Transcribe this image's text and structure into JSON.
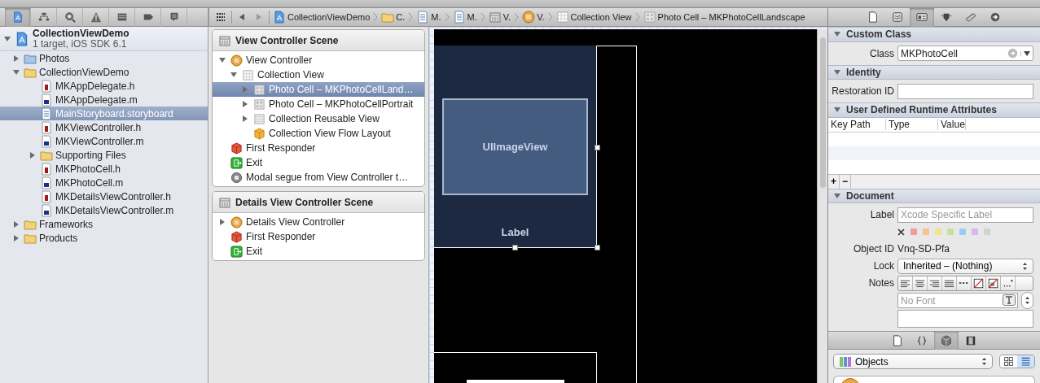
{
  "navigator": {
    "tabs": [
      {
        "kind": "project",
        "selected": true
      },
      {
        "kind": "symbol",
        "selected": false
      },
      {
        "kind": "search",
        "selected": false
      },
      {
        "kind": "issue",
        "selected": false
      },
      {
        "kind": "debug",
        "selected": false
      },
      {
        "kind": "breakpoint",
        "selected": false
      },
      {
        "kind": "log",
        "selected": false
      }
    ],
    "project": {
      "name": "CollectionViewDemo",
      "subtitle": "1 target, iOS SDK 6.1",
      "expanded": true,
      "selected": false
    },
    "items": [
      {
        "label": "Photos",
        "kind": "bluefolder",
        "expanded": false,
        "selected": false
      },
      {
        "label": "CollectionViewDemo",
        "kind": "folder",
        "expanded": true,
        "selected": false,
        "children": [
          {
            "label": "MKAppDelegate.h",
            "kind": "header",
            "selected": false
          },
          {
            "label": "MKAppDelegate.m",
            "kind": "source",
            "selected": false
          },
          {
            "label": "MainStoryboard.storyboard",
            "kind": "storyboard",
            "selected": true
          },
          {
            "label": "MKViewController.h",
            "kind": "header",
            "selected": false
          },
          {
            "label": "MKViewController.m",
            "kind": "source",
            "selected": false
          },
          {
            "label": "Supporting Files",
            "kind": "folder",
            "expanded": false,
            "selected": false
          },
          {
            "label": "MKPhotoCell.h",
            "kind": "header",
            "selected": false
          },
          {
            "label": "MKPhotoCell.m",
            "kind": "source",
            "selected": false
          },
          {
            "label": "MKDetailsViewController.h",
            "kind": "header",
            "selected": false
          },
          {
            "label": "MKDetailsViewController.m",
            "kind": "source",
            "selected": false
          }
        ]
      },
      {
        "label": "Frameworks",
        "kind": "folder",
        "expanded": false,
        "selected": false
      },
      {
        "label": "Products",
        "kind": "folder",
        "expanded": false,
        "selected": false
      }
    ]
  },
  "jump_bar": {
    "crumbs": [
      {
        "label": "CollectionViewDemo",
        "kind": "project"
      },
      {
        "label": "C.",
        "kind": "folder"
      },
      {
        "label": "M.",
        "kind": "storyboard"
      },
      {
        "label": "M.",
        "kind": "storyboard"
      },
      {
        "label": "V.",
        "kind": "scene"
      },
      {
        "label": "V.",
        "kind": "controller"
      },
      {
        "label": "Collection View",
        "kind": "collection"
      },
      {
        "label": "Photo Cell – MKPhotoCellLandscape",
        "kind": "cell"
      }
    ]
  },
  "outline": {
    "scenes": [
      {
        "title": "View Controller Scene",
        "items": [
          {
            "label": "View Controller",
            "kind": "controller",
            "expanded": true,
            "selected": false,
            "children": [
              {
                "label": "Collection View",
                "kind": "collection",
                "expanded": true,
                "selected": false,
                "children": [
                  {
                    "label": "Photo Cell – MKPhotoCellLand…",
                    "kind": "cell",
                    "expanded": false,
                    "selected": true
                  },
                  {
                    "label": "Photo Cell – MKPhotoCellPortrait",
                    "kind": "cell",
                    "expanded": false,
                    "selected": false
                  },
                  {
                    "label": "Collection Reusable View",
                    "kind": "reusable",
                    "expanded": false,
                    "selected": false
                  },
                  {
                    "label": "Collection View Flow Layout",
                    "kind": "layout",
                    "selected": false
                  }
                ]
              }
            ]
          },
          {
            "label": "First Responder",
            "kind": "responder",
            "selected": false
          },
          {
            "label": "Exit",
            "kind": "exit",
            "selected": false
          },
          {
            "label": "Modal segue from View Controller t…",
            "kind": "segue",
            "selected": false
          }
        ]
      },
      {
        "title": "Details View Controller Scene",
        "items": [
          {
            "label": "Details View Controller",
            "kind": "controller",
            "expanded": false,
            "selected": false
          },
          {
            "label": "First Responder",
            "kind": "responder",
            "selected": false
          },
          {
            "label": "Exit",
            "kind": "exit",
            "selected": false
          }
        ]
      }
    ]
  },
  "canvas": {
    "image_view": "UIImageView",
    "cell_label": "Label"
  },
  "inspector": {
    "tabs": [
      {
        "kind": "file",
        "selected": false
      },
      {
        "kind": "quickhelp",
        "selected": false
      },
      {
        "kind": "identity",
        "selected": true
      },
      {
        "kind": "attributes",
        "selected": false
      },
      {
        "kind": "size",
        "selected": false
      },
      {
        "kind": "connections",
        "selected": false
      }
    ],
    "sections": [
      {
        "kind": "customclass",
        "title": "Custom Class",
        "expanded": true,
        "class_label": "Class",
        "class_value": "MKPhotoCell"
      },
      {
        "kind": "identity",
        "title": "Identity",
        "expanded": true,
        "restoration_label": "Restoration ID"
      },
      {
        "kind": "runtime",
        "title": "User Defined Runtime Attributes",
        "expanded": true,
        "columns": [
          "Key Path",
          "Type",
          "Value"
        ],
        "add_button": "+",
        "remove_button": "−"
      },
      {
        "kind": "document",
        "title": "Document",
        "expanded": true,
        "label_label": "Label",
        "label_placeholder": "Xcode Specific Label",
        "label_colors": [
          {
            "color": "#f29b9b"
          },
          {
            "color": "#f6c58f"
          },
          {
            "color": "#f1e48e"
          },
          {
            "color": "#c7e09c"
          },
          {
            "color": "#9ccbf3"
          },
          {
            "color": "#dbb6ea"
          },
          {
            "color": "#d2d2d2"
          }
        ],
        "object_id_label": "Object ID",
        "object_id": "Vnq-SD-Pfa",
        "lock_label": "Lock",
        "lock_value": "Inherited – (Nothing)",
        "notes_label": "Notes",
        "notes_buttons": [
          {
            "kind": "left"
          },
          {
            "kind": "center"
          },
          {
            "kind": "right"
          },
          {
            "kind": "justify"
          },
          {
            "kind": "dashes"
          },
          {
            "kind": "nocolor"
          },
          {
            "kind": "nobg"
          },
          {
            "kind": "more"
          }
        ],
        "font_placeholder": "No Font"
      }
    ]
  },
  "library": {
    "tabs": [
      {
        "kind": "filetemplate",
        "selected": false
      },
      {
        "kind": "snippet",
        "selected": false
      },
      {
        "kind": "object",
        "selected": true
      },
      {
        "kind": "media",
        "selected": false
      }
    ],
    "filter": "Objects",
    "views": [
      {
        "kind": "grid",
        "selected": false
      },
      {
        "kind": "list",
        "selected": true
      }
    ]
  }
}
